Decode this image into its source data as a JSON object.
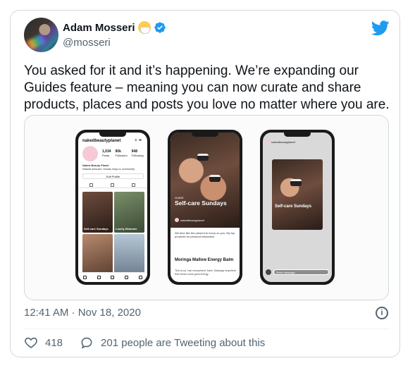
{
  "author": {
    "name": "Adam Mosseri",
    "handle": "@mosseri"
  },
  "tweet": {
    "text": "You asked for it and it’s happening. We’re expanding our Guides feature – meaning you can now curate and share products, places and posts you love no matter where you are."
  },
  "media": {
    "phone1": {
      "username": "nakedbeautyplanet",
      "stats": [
        {
          "value": "1,034",
          "label": "Posts"
        },
        {
          "value": "90k",
          "label": "Followers"
        },
        {
          "value": "948",
          "label": "Following"
        }
      ],
      "bio_name": "Naked Beauty Planet",
      "bio_text": "Natural skincare, beauty inspo & community",
      "edit_button": "Edit Profile",
      "grid_label_1": "Self-care Sundays",
      "grid_label_2": "Lovely Skincare"
    },
    "phone2": {
      "guide_tag": "GUIDE",
      "title": "Self-care Sundays",
      "account": "nakedbeautyplanet",
      "body": "We time like the present to focus on you. My top products for personal relaxation.",
      "item_title": "Moringa Mallow Energy Balm",
      "item_body": "This is my \"use everywhere\" balm. Massage anywhere that needs some good energy."
    },
    "phone3": {
      "account": "nakedbeautyplanet",
      "post_title": "Self-care Sundays",
      "send_message": "Send message"
    }
  },
  "timestamp": "12:41 AM · Nov 18, 2020",
  "actions": {
    "likes": "418",
    "tweeting": "201 people are Tweeting about this"
  },
  "colors": {
    "twitter_blue": "#1d9bf0",
    "verified_blue": "#1d9bf0",
    "secondary_text": "#536471"
  }
}
